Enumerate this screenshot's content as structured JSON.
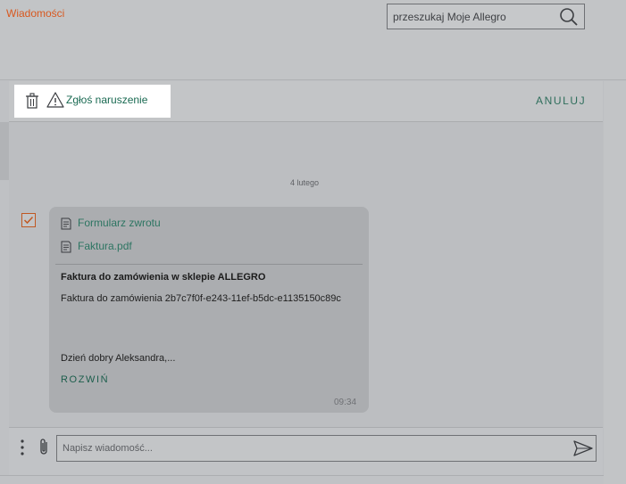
{
  "header": {
    "brand_link": "Wiadomości",
    "search_placeholder": "przeszukaj Moje Allegro",
    "search_icon": "search-icon"
  },
  "actionbar": {
    "delete_icon": "trash-icon",
    "report_label": "Zgłoś naruszenie",
    "report_icon": "warning-icon",
    "cancel_label": "ANULUJ"
  },
  "thread": {
    "date": "4 lutego",
    "message": {
      "selected": true,
      "attachments": [
        "Formularz zwrotu",
        "Faktura.pdf"
      ],
      "subject": "Faktura do zamówienia w sklepie ALLEGRO",
      "body_line1": "Faktura do zamówienia 2b7c7f0f-e243-11ef-b5dc-e1135150c89c",
      "body_line2": "Dzień dobry Aleksandra,...",
      "expand_label": "ROZWIŃ",
      "time": "09:34"
    }
  },
  "composer": {
    "placeholder": "Napisz wiadomość...",
    "more_icon": "more-vertical-icon",
    "attach_icon": "paperclip-icon",
    "send_icon": "send-icon"
  },
  "colors": {
    "accent_green": "#1a6a52",
    "brand_orange": "#d8581f",
    "checkbox_orange": "#c05822"
  }
}
